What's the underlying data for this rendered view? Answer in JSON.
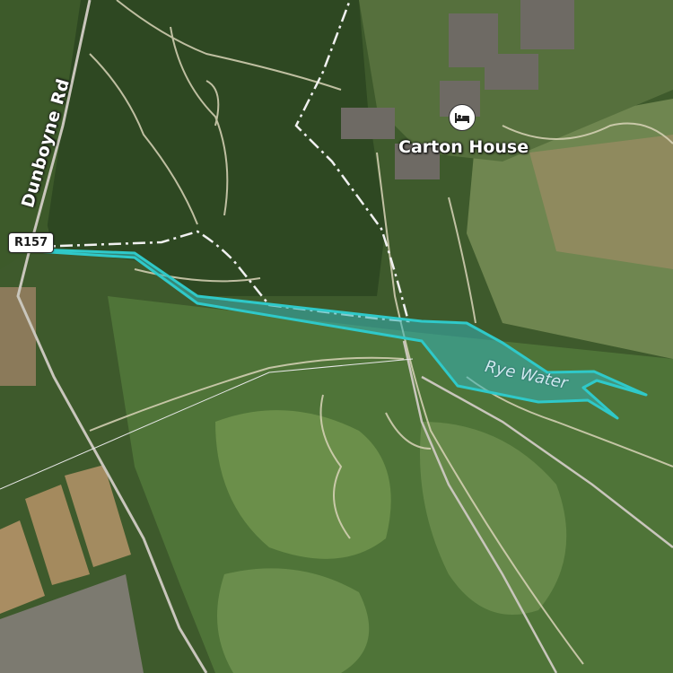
{
  "map": {
    "labels": {
      "road_name": "Dunboyne Rd",
      "route_shield": "R157",
      "poi_name": "Carton House",
      "water_name": "Rye Water"
    },
    "poi": {
      "category": "hotel",
      "icon": "bed-icon"
    },
    "colors": {
      "highlight": "#2fc9c9",
      "highlight_fill": "#35b3b6",
      "path": "#d9d4b8",
      "boundary": "#e8e8e8",
      "grass": "#557b3a",
      "forest": "#2f4a24"
    }
  }
}
